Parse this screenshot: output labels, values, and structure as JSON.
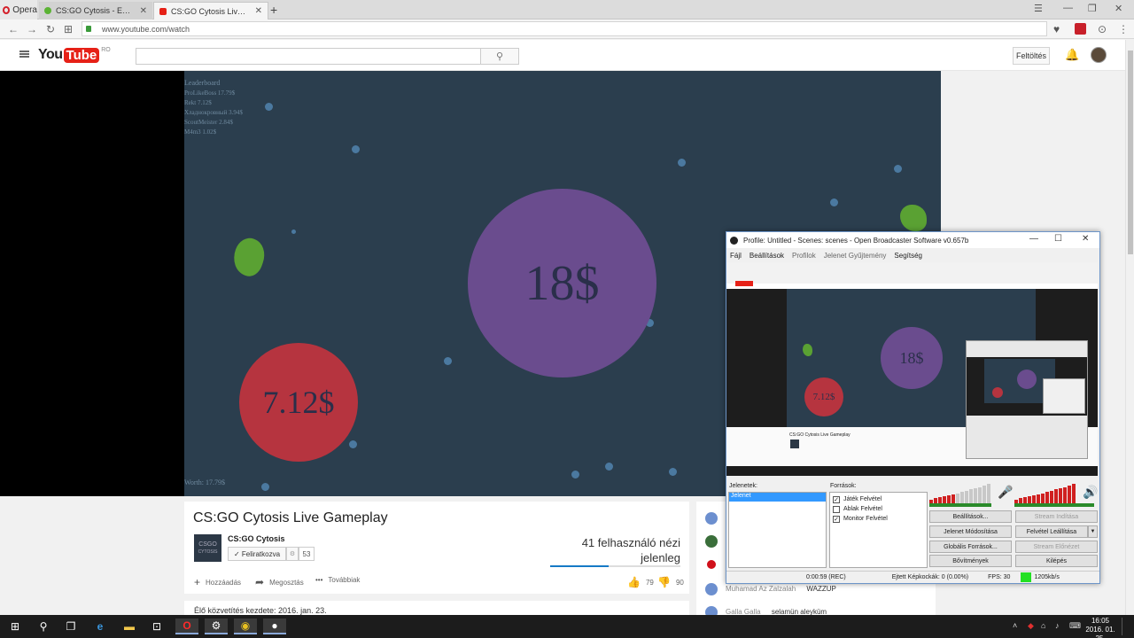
{
  "browser": {
    "menu_label": "Opera",
    "tabs": [
      {
        "title": "CS:GO Cytosis - Eat Cells",
        "close": "✕",
        "favicon_color": "#5bb334"
      },
      {
        "title": "CS:GO Cytosis Live Gamep",
        "close": "✕",
        "favicon_color": "#e62117"
      }
    ],
    "new_tab": "+",
    "window_controls": [
      "☰",
      "—",
      "❐",
      "✕"
    ],
    "url": "www.youtube.com/watch",
    "nav_icons": [
      "back-icon",
      "forward-icon",
      "reload-icon",
      "tabs-grid-icon"
    ],
    "toolbar_icons": [
      "heart-icon",
      "gift-icon",
      "download-icon",
      "menu-icon"
    ]
  },
  "youtube": {
    "logo_you": "You",
    "logo_tube": "Tube",
    "logo_region": "RO",
    "search_placeholder": "",
    "search_icon": "⚲",
    "upload_label": "Feltöltés",
    "bell_icon": "🔔"
  },
  "game": {
    "leaderboard_title": "Leaderboard",
    "leaderboard": [
      "ProLikeBoss 17.79$",
      "Rekt 7.12$",
      "Хладнокровный 3.94$",
      "ScoutMeister 2.84$",
      "M4m3 1.02$"
    ],
    "worth": "Worth: 17.79$",
    "cells": [
      {
        "label": "18$",
        "color": "#6a4c8e"
      },
      {
        "label": "7.12$",
        "color": "#b6343f"
      }
    ]
  },
  "video": {
    "title": "CS:GO Cytosis Live Gameplay",
    "channel_thumb_top": "CSGO",
    "channel_thumb_bottom": "CYTOSIS",
    "channel_name": "CS:GO Cytosis",
    "subscribed_label": "✓  Feliratkozva",
    "gear": "⚙",
    "subscriber_count": "53",
    "viewers_line1": "41 felhasználó nézi",
    "viewers_line2": "jelenleg",
    "viewer_fraction": 0.45,
    "actions": [
      {
        "icon": "+",
        "label": "Hozzáadás"
      },
      {
        "icon": "➦",
        "label": "Megosztás"
      },
      {
        "icon": "•••",
        "label": "Továbbiak"
      }
    ],
    "likes": "79",
    "dislikes": "90",
    "live_started": "Élő közvetítés kezdete: 2016. jan. 23."
  },
  "chat": {
    "messages": [
      {
        "user": "Muhamad Az Zalzalah",
        "text": "WAZZUP"
      },
      {
        "user": "Galla Galla",
        "text": "selamün aleyküm"
      }
    ]
  },
  "obs": {
    "title": "Profile: Untitled - Scenes: scenes - Open Broadcaster Software v0.657b",
    "menu": [
      "Fájl",
      "Beállítások",
      "Profilok",
      "Jelenet Gyűjtemény",
      "Segítség"
    ],
    "scenes_label": "Jelenetek:",
    "scenes": [
      "Jelenet"
    ],
    "sources_label": "Források:",
    "sources": [
      {
        "name": "Játék Felvétel",
        "checked": "✓"
      },
      {
        "name": "Ablak Felvétel",
        "checked": ""
      },
      {
        "name": "Monitor Felvétel",
        "checked": "✓"
      }
    ],
    "buttons": {
      "settings": "Beállítások...",
      "start_stream": "Stream Indítása",
      "edit_scene": "Jelenet Módosítása",
      "stop_recording": "Felvétel Leállítása",
      "global_sources": "Globális Források...",
      "stream_preview": "Stream Előnézet",
      "plugins": "Bővítmények",
      "exit": "Kilépés"
    },
    "status_time": "0:00:59 (REC)",
    "dropped_frames": "Ejtett Képkockák: 0 (0.00%)",
    "fps": "FPS: 30",
    "bitrate": "1205kb/s",
    "preview_cell_labels": [
      "18$",
      "7.12$"
    ],
    "preview_title": "CS:GO Cytosis Live Gameplay"
  },
  "taskbar": {
    "time": "16:05",
    "date": "2016. 01. 25."
  }
}
